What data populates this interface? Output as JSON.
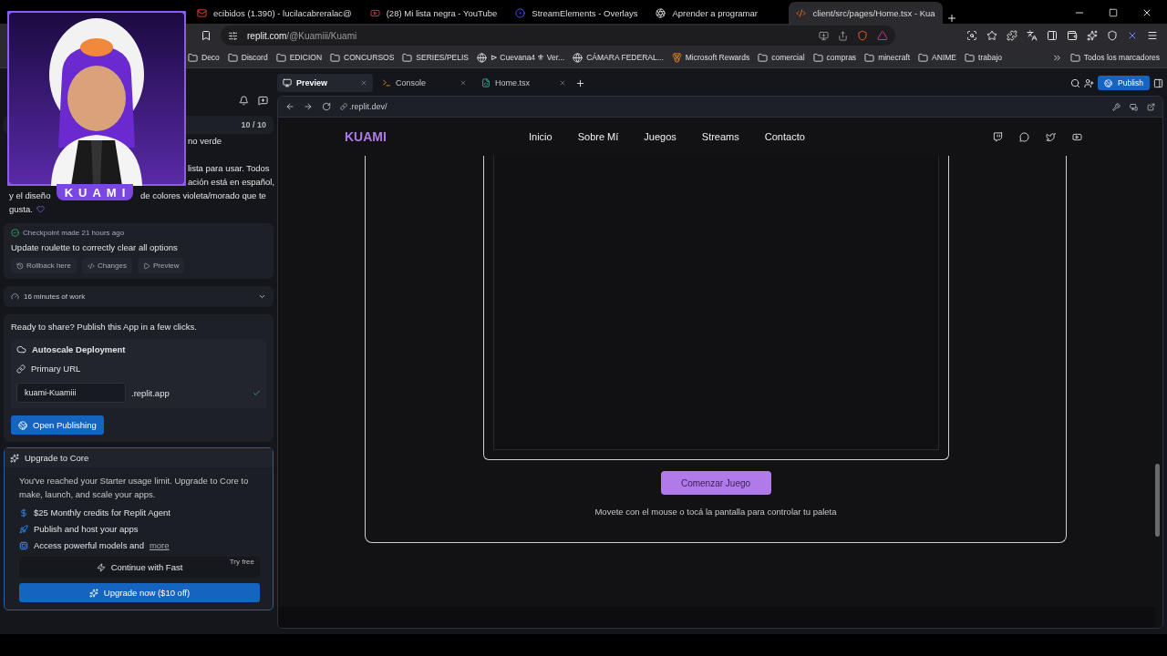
{
  "overlay": {
    "name": "KUAMI"
  },
  "browser_tabs": [
    {
      "kind": "mail",
      "title": "ecibidos (1.390) - lucilacabreralac@",
      "selected": false
    },
    {
      "kind": "video",
      "title": "(28) Mi lista negra - YouTube",
      "selected": false
    },
    {
      "kind": "overlay",
      "title": "StreamElements - Overlays",
      "selected": false
    },
    {
      "kind": "learn",
      "title": "Aprender a programar",
      "selected": false
    },
    {
      "kind": "code",
      "title": "client/src/pages/Home.tsx - Kua",
      "selected": true
    }
  ],
  "address": {
    "host": "replit.com",
    "path": "/@Kuamiii/Kuami"
  },
  "bookmarks": [
    {
      "kind": "folder",
      "label": "Deco"
    },
    {
      "kind": "folder",
      "label": "Discord"
    },
    {
      "kind": "folder",
      "label": "EDICION"
    },
    {
      "kind": "folder",
      "label": "CONCURSOS"
    },
    {
      "kind": "folder",
      "label": "SERIES/PELIS"
    },
    {
      "kind": "site",
      "label": "⊳ Cuevana4 ⚜ Ver..."
    },
    {
      "kind": "site",
      "label": "CÁMARA FEDERAL..."
    },
    {
      "kind": "medal",
      "label": "Microsoft Rewards"
    },
    {
      "kind": "folder",
      "label": "comercial"
    },
    {
      "kind": "folder",
      "label": "compras"
    },
    {
      "kind": "folder",
      "label": "minecraft"
    },
    {
      "kind": "folder",
      "label": "ANIME"
    },
    {
      "kind": "folder",
      "label": "trabajo"
    }
  ],
  "all_bookmarks": "Todos los marcadores",
  "agent": {
    "counter": "10 / 10",
    "message_lines": [
      {
        "kind": "covered",
        "parts": [
          "no verde"
        ]
      },
      {
        "kind": "blank"
      },
      {
        "kind": "covered",
        "parts": [
          "lista para usar. Todos"
        ]
      },
      {
        "kind": "covered",
        "parts": [
          "ación está en español,"
        ]
      },
      {
        "kind": "split",
        "parts": [
          "y el diseño",
          "de colores violeta/morado que te"
        ]
      },
      {
        "kind": "heart",
        "parts": [
          "gusta."
        ]
      }
    ],
    "checkpoint": {
      "meta": "Checkpoint made 21 hours ago",
      "title": "Update roulette to correctly clear all options",
      "actions": [
        {
          "kind": "rollback",
          "label": "Rollback here"
        },
        {
          "kind": "changes",
          "label": "Changes"
        },
        {
          "kind": "preview",
          "label": "Preview"
        }
      ]
    },
    "work": {
      "label": "16 minutes of work",
      "expanded": false
    },
    "publish": {
      "prompt": "Ready to share? Publish this App in a few clicks.",
      "deployment": "Autoscale Deployment",
      "url_label": "Primary URL",
      "url_value": "kuami-Kuamiii",
      "url_suffix": ".replit.app",
      "verified": true,
      "button": "Open Publishing"
    },
    "upgrade": {
      "title": "Upgrade to Core",
      "description": "You've reached your Starter usage limit. Upgrade to Core to make, launch, and scale your apps.",
      "features": [
        {
          "kind": "dollar",
          "text": "$25 Monthly credits for Replit Agent"
        },
        {
          "kind": "rocket",
          "text": "Publish and host your apps"
        },
        {
          "kind": "chip",
          "text": "Access powerful models and",
          "link": "more"
        }
      ],
      "continue": "Continue with Fast",
      "try_free": "Try free",
      "button": "Upgrade now ($10 off)"
    }
  },
  "workspace": {
    "tabs": [
      {
        "kind": "preview",
        "label": "Preview",
        "selected": true
      },
      {
        "kind": "console",
        "label": "Console",
        "selected": false
      },
      {
        "kind": "file",
        "label": "Home.tsx",
        "selected": false
      }
    ],
    "publish": "Publish",
    "url": ".replit.dev/"
  },
  "site": {
    "logo": "KUAMI",
    "nav": [
      "Inicio",
      "Sobre Mí",
      "Juegos",
      "Streams",
      "Contacto"
    ],
    "socials": [
      {
        "kind": "twitch"
      },
      {
        "kind": "discord"
      },
      {
        "kind": "twitter"
      },
      {
        "kind": "youtube"
      }
    ],
    "start_button": "Comenzar Juego",
    "hint": "Movete con el mouse o tocá la pantalla para controlar tu paleta"
  }
}
